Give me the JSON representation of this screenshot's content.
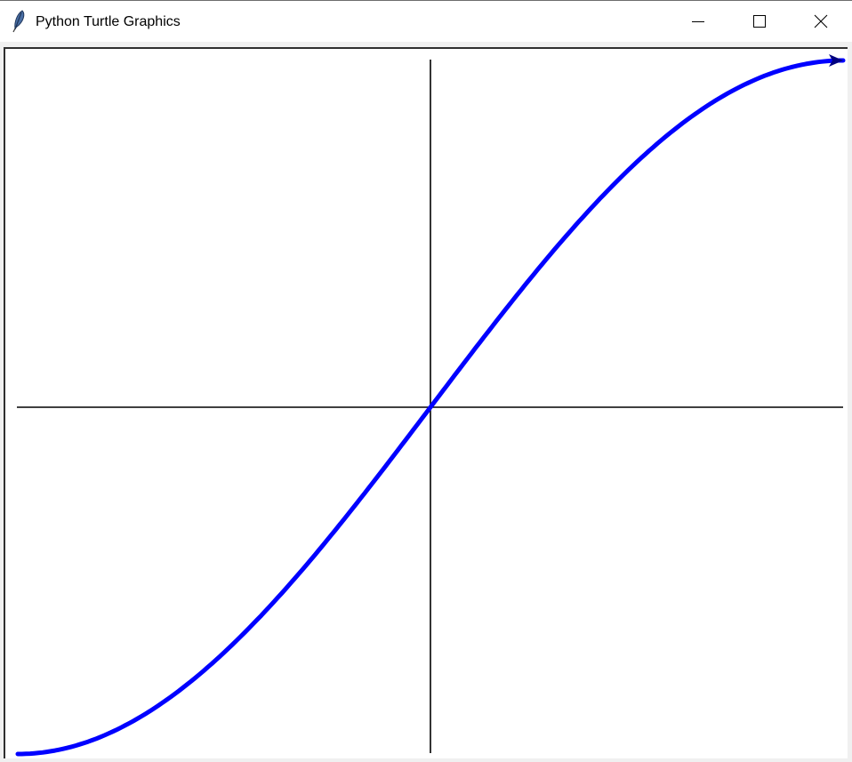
{
  "window": {
    "title": "Python Turtle Graphics",
    "icon": "feather-icon",
    "controls": {
      "minimize_icon": "minimize-icon",
      "maximize_icon": "maximize-icon",
      "close_icon": "close-icon"
    }
  },
  "colors": {
    "curve": "#0000ff",
    "axes": "#000000",
    "canvas_background": "#ffffff",
    "turtle": "#000080"
  }
}
